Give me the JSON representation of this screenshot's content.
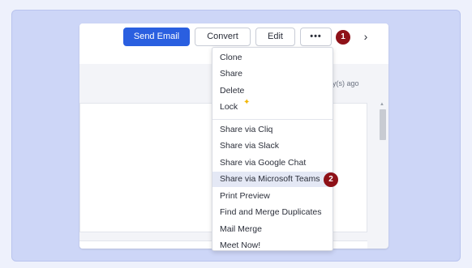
{
  "toolbar": {
    "send_email": "Send Email",
    "convert": "Convert",
    "edit": "Edit",
    "more": "•••",
    "next_icon": "›"
  },
  "record": {
    "time_text": "ay(s) ago"
  },
  "menu": {
    "items": [
      "Clone",
      "Share",
      "Delete",
      "Lock",
      "Share via Cliq",
      "Share via Slack",
      "Share via Google Chat",
      "Share via Microsoft Teams",
      "Print Preview",
      "Find and Merge Duplicates",
      "Mail Merge",
      "Meet Now!"
    ],
    "highlighted": "Share via Microsoft Teams",
    "sparkle": "✦"
  },
  "badges": {
    "one": "1",
    "two": "2"
  },
  "scroll_up_icon": "▲",
  "colors": {
    "primary": "#2a5fe0",
    "badge": "#8e1118",
    "sparkle": "#f2b705",
    "frame": "#cdd6f7"
  }
}
